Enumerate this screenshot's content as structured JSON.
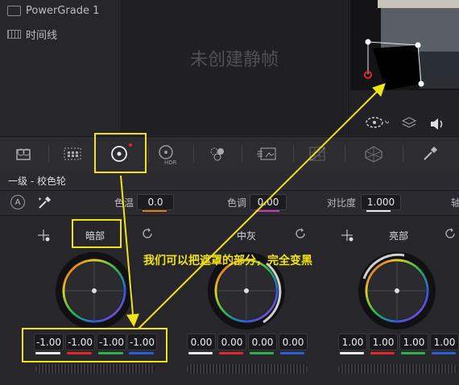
{
  "gallery": {
    "items": [
      {
        "label": "PowerGrade 1",
        "icon": "folder-icon"
      },
      {
        "label": "时间线",
        "icon": "timeline-icon"
      }
    ]
  },
  "viewer": {
    "empty_text": "未创建静帧"
  },
  "panel": {
    "title": "一级 - 校色轮"
  },
  "params": {
    "temp_label": "色温",
    "temp_value": "0.0",
    "tint_label": "色调",
    "tint_value": "0.00",
    "contrast_label": "对比度",
    "contrast_value": "1.000",
    "pivot_label_partial": "轴"
  },
  "wheels": [
    {
      "name": "暗部",
      "values": [
        "-1.00",
        "-1.00",
        "-1.00",
        "-1.00"
      ],
      "icon": "picker-icon"
    },
    {
      "name": "中灰",
      "values": [
        "0.00",
        "0.00",
        "0.00",
        "0.00"
      ]
    },
    {
      "name": "亮部",
      "values": [
        "1.00",
        "1.00",
        "1.00",
        "1.00"
      ],
      "icon": "picker-icon"
    }
  ],
  "annotation": {
    "text": "我们可以把遮罩的部分，完全变黑"
  },
  "colors": {
    "annotation": "#f2e21a",
    "channel_y": "#e8e8e8",
    "channel_r": "#e0282a",
    "channel_g": "#2bb24a",
    "channel_b": "#2a5ed8",
    "temp_underline": "#e07a22",
    "tint_underline": "#c838b8"
  }
}
